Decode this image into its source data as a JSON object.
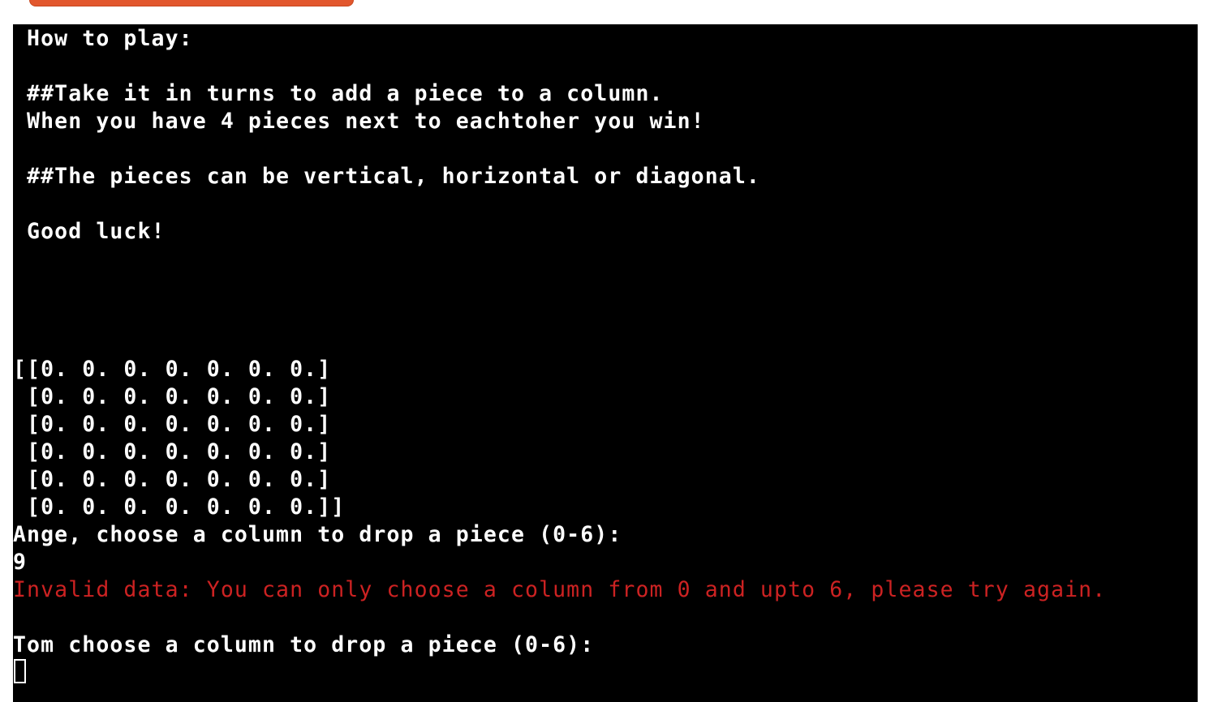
{
  "terminal": {
    "lines": [
      " How to play:",
      "",
      " ##Take it in turns to add a piece to a column.",
      " When you have 4 pieces next to eachtoher you win!",
      "",
      " ##The pieces can be vertical, horizontal or diagonal.",
      "",
      " Good luck!",
      "",
      "",
      "",
      "",
      "[[0. 0. 0. 0. 0. 0. 0.]",
      " [0. 0. 0. 0. 0. 0. 0.]",
      " [0. 0. 0. 0. 0. 0. 0.]",
      " [0. 0. 0. 0. 0. 0. 0.]",
      " [0. 0. 0. 0. 0. 0. 0.]",
      " [0. 0. 0. 0. 0. 0. 0.]]",
      "Ange, choose a column to drop a piece (0-6):",
      "9",
      "Invalid data: You can only choose a column from 0 and upto 6, please try again.",
      "",
      "Tom choose a column to drop a piece (0-6):"
    ],
    "error_color": "#cc2222",
    "text_color": "#ffffff",
    "background": "#000000"
  },
  "run_button": {
    "color": "#e2572d"
  }
}
